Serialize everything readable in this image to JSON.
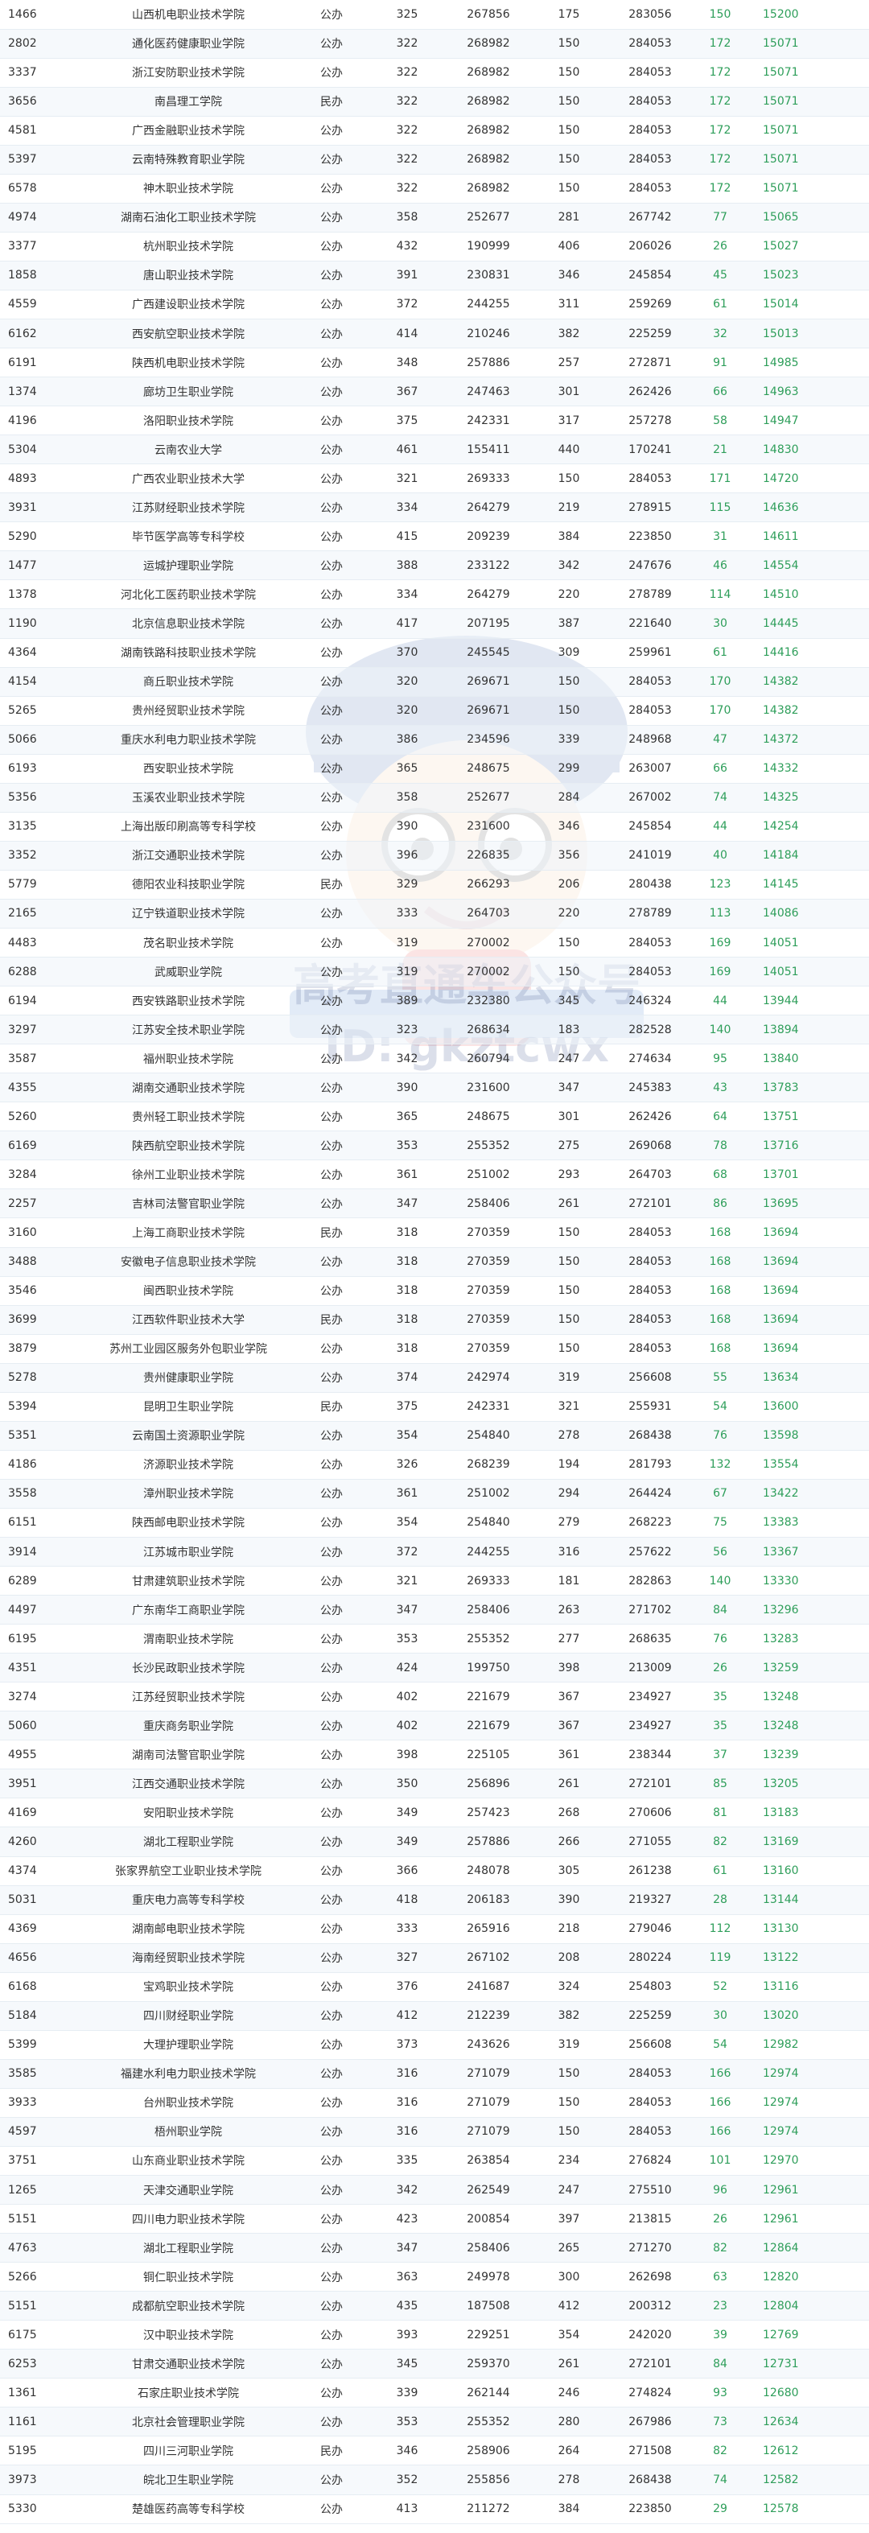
{
  "watermark": {
    "line1": "高考直通车公众号",
    "line2": "ID: gkztcwx"
  },
  "rows": [
    [
      "1466",
      "山西机电职业技术学院",
      "公办",
      "325",
      "267856",
      "175",
      "283056",
      "150",
      "15200"
    ],
    [
      "2802",
      "通化医药健康职业学院",
      "公办",
      "322",
      "268982",
      "150",
      "284053",
      "172",
      "15071"
    ],
    [
      "3337",
      "浙江安防职业技术学院",
      "公办",
      "322",
      "268982",
      "150",
      "284053",
      "172",
      "15071"
    ],
    [
      "3656",
      "南昌理工学院",
      "民办",
      "322",
      "268982",
      "150",
      "284053",
      "172",
      "15071"
    ],
    [
      "4581",
      "广西金融职业技术学院",
      "公办",
      "322",
      "268982",
      "150",
      "284053",
      "172",
      "15071"
    ],
    [
      "5397",
      "云南特殊教育职业学院",
      "公办",
      "322",
      "268982",
      "150",
      "284053",
      "172",
      "15071"
    ],
    [
      "6578",
      "神木职业技术学院",
      "公办",
      "322",
      "268982",
      "150",
      "284053",
      "172",
      "15071"
    ],
    [
      "4974",
      "湖南石油化工职业技术学院",
      "公办",
      "358",
      "252677",
      "281",
      "267742",
      "77",
      "15065"
    ],
    [
      "3377",
      "杭州职业技术学院",
      "公办",
      "432",
      "190999",
      "406",
      "206026",
      "26",
      "15027"
    ],
    [
      "1858",
      "唐山职业技术学院",
      "公办",
      "391",
      "230831",
      "346",
      "245854",
      "45",
      "15023"
    ],
    [
      "4559",
      "广西建设职业技术学院",
      "公办",
      "372",
      "244255",
      "311",
      "259269",
      "61",
      "15014"
    ],
    [
      "6162",
      "西安航空职业技术学院",
      "公办",
      "414",
      "210246",
      "382",
      "225259",
      "32",
      "15013"
    ],
    [
      "6191",
      "陕西机电职业技术学院",
      "公办",
      "348",
      "257886",
      "257",
      "272871",
      "91",
      "14985"
    ],
    [
      "1374",
      "廊坊卫生职业学院",
      "公办",
      "367",
      "247463",
      "301",
      "262426",
      "66",
      "14963"
    ],
    [
      "4196",
      "洛阳职业技术学院",
      "公办",
      "375",
      "242331",
      "317",
      "257278",
      "58",
      "14947"
    ],
    [
      "5304",
      "云南农业大学",
      "公办",
      "461",
      "155411",
      "440",
      "170241",
      "21",
      "14830"
    ],
    [
      "4893",
      "广西农业职业技术大学",
      "公办",
      "321",
      "269333",
      "150",
      "284053",
      "171",
      "14720"
    ],
    [
      "3931",
      "江苏财经职业技术学院",
      "公办",
      "334",
      "264279",
      "219",
      "278915",
      "115",
      "14636"
    ],
    [
      "5290",
      "毕节医学高等专科学校",
      "公办",
      "415",
      "209239",
      "384",
      "223850",
      "31",
      "14611"
    ],
    [
      "1477",
      "运城护理职业学院",
      "公办",
      "388",
      "233122",
      "342",
      "247676",
      "46",
      "14554"
    ],
    [
      "1378",
      "河北化工医药职业技术学院",
      "公办",
      "334",
      "264279",
      "220",
      "278789",
      "114",
      "14510"
    ],
    [
      "1190",
      "北京信息职业技术学院",
      "公办",
      "417",
      "207195",
      "387",
      "221640",
      "30",
      "14445"
    ],
    [
      "4364",
      "湖南铁路科技职业技术学院",
      "公办",
      "370",
      "245545",
      "309",
      "259961",
      "61",
      "14416"
    ],
    [
      "4154",
      "商丘职业技术学院",
      "公办",
      "320",
      "269671",
      "150",
      "284053",
      "170",
      "14382"
    ],
    [
      "5265",
      "贵州经贸职业技术学院",
      "公办",
      "320",
      "269671",
      "150",
      "284053",
      "170",
      "14382"
    ],
    [
      "5066",
      "重庆水利电力职业技术学院",
      "公办",
      "386",
      "234596",
      "339",
      "248968",
      "47",
      "14372"
    ],
    [
      "6193",
      "西安职业技术学院",
      "公办",
      "365",
      "248675",
      "299",
      "263007",
      "66",
      "14332"
    ],
    [
      "5356",
      "玉溪农业职业技术学院",
      "公办",
      "358",
      "252677",
      "284",
      "267002",
      "74",
      "14325"
    ],
    [
      "3135",
      "上海出版印刷高等专科学校",
      "公办",
      "390",
      "231600",
      "346",
      "245854",
      "44",
      "14254"
    ],
    [
      "3352",
      "浙江交通职业技术学院",
      "公办",
      "396",
      "226835",
      "356",
      "241019",
      "40",
      "14184"
    ],
    [
      "5779",
      "德阳农业科技职业学院",
      "民办",
      "329",
      "266293",
      "206",
      "280438",
      "123",
      "14145"
    ],
    [
      "2165",
      "辽宁铁道职业技术学院",
      "公办",
      "333",
      "264703",
      "220",
      "278789",
      "113",
      "14086"
    ],
    [
      "4483",
      "茂名职业技术学院",
      "公办",
      "319",
      "270002",
      "150",
      "284053",
      "169",
      "14051"
    ],
    [
      "6288",
      "武威职业学院",
      "公办",
      "319",
      "270002",
      "150",
      "284053",
      "169",
      "14051"
    ],
    [
      "6194",
      "西安铁路职业技术学院",
      "公办",
      "389",
      "232380",
      "345",
      "246324",
      "44",
      "13944"
    ],
    [
      "3297",
      "江苏安全技术职业学院",
      "公办",
      "323",
      "268634",
      "183",
      "282528",
      "140",
      "13894"
    ],
    [
      "3587",
      "福州职业技术学院",
      "公办",
      "342",
      "260794",
      "247",
      "274634",
      "95",
      "13840"
    ],
    [
      "4355",
      "湖南交通职业技术学院",
      "公办",
      "390",
      "231600",
      "347",
      "245383",
      "43",
      "13783"
    ],
    [
      "5260",
      "贵州轻工职业技术学院",
      "公办",
      "365",
      "248675",
      "301",
      "262426",
      "64",
      "13751"
    ],
    [
      "6169",
      "陕西航空职业技术学院",
      "公办",
      "353",
      "255352",
      "275",
      "269068",
      "78",
      "13716"
    ],
    [
      "3284",
      "徐州工业职业技术学院",
      "公办",
      "361",
      "251002",
      "293",
      "264703",
      "68",
      "13701"
    ],
    [
      "2257",
      "吉林司法警官职业学院",
      "公办",
      "347",
      "258406",
      "261",
      "272101",
      "86",
      "13695"
    ],
    [
      "3160",
      "上海工商职业技术学院",
      "民办",
      "318",
      "270359",
      "150",
      "284053",
      "168",
      "13694"
    ],
    [
      "3488",
      "安徽电子信息职业技术学院",
      "公办",
      "318",
      "270359",
      "150",
      "284053",
      "168",
      "13694"
    ],
    [
      "3546",
      "闽西职业技术学院",
      "公办",
      "318",
      "270359",
      "150",
      "284053",
      "168",
      "13694"
    ],
    [
      "3699",
      "江西软件职业技术大学",
      "民办",
      "318",
      "270359",
      "150",
      "284053",
      "168",
      "13694"
    ],
    [
      "3879",
      "苏州工业园区服务外包职业学院",
      "公办",
      "318",
      "270359",
      "150",
      "284053",
      "168",
      "13694"
    ],
    [
      "5278",
      "贵州健康职业学院",
      "公办",
      "374",
      "242974",
      "319",
      "256608",
      "55",
      "13634"
    ],
    [
      "5394",
      "昆明卫生职业学院",
      "民办",
      "375",
      "242331",
      "321",
      "255931",
      "54",
      "13600"
    ],
    [
      "5351",
      "云南国土资源职业学院",
      "公办",
      "354",
      "254840",
      "278",
      "268438",
      "76",
      "13598"
    ],
    [
      "4186",
      "济源职业技术学院",
      "公办",
      "326",
      "268239",
      "194",
      "281793",
      "132",
      "13554"
    ],
    [
      "3558",
      "漳州职业技术学院",
      "公办",
      "361",
      "251002",
      "294",
      "264424",
      "67",
      "13422"
    ],
    [
      "6151",
      "陕西邮电职业技术学院",
      "公办",
      "354",
      "254840",
      "279",
      "268223",
      "75",
      "13383"
    ],
    [
      "3914",
      "江苏城市职业学院",
      "公办",
      "372",
      "244255",
      "316",
      "257622",
      "56",
      "13367"
    ],
    [
      "6289",
      "甘肃建筑职业技术学院",
      "公办",
      "321",
      "269333",
      "181",
      "282863",
      "140",
      "13330"
    ],
    [
      "4497",
      "广东南华工商职业学院",
      "公办",
      "347",
      "258406",
      "263",
      "271702",
      "84",
      "13296"
    ],
    [
      "6195",
      "渭南职业技术学院",
      "公办",
      "353",
      "255352",
      "277",
      "268635",
      "76",
      "13283"
    ],
    [
      "4351",
      "长沙民政职业技术学院",
      "公办",
      "424",
      "199750",
      "398",
      "213009",
      "26",
      "13259"
    ],
    [
      "3274",
      "江苏经贸职业技术学院",
      "公办",
      "402",
      "221679",
      "367",
      "234927",
      "35",
      "13248"
    ],
    [
      "5060",
      "重庆商务职业学院",
      "公办",
      "402",
      "221679",
      "367",
      "234927",
      "35",
      "13248"
    ],
    [
      "4955",
      "湖南司法警官职业学院",
      "公办",
      "398",
      "225105",
      "361",
      "238344",
      "37",
      "13239"
    ],
    [
      "3951",
      "江西交通职业技术学院",
      "公办",
      "350",
      "256896",
      "261",
      "272101",
      "85",
      "13205"
    ],
    [
      "4169",
      "安阳职业技术学院",
      "公办",
      "349",
      "257423",
      "268",
      "270606",
      "81",
      "13183"
    ],
    [
      "4260",
      "湖北工程职业学院",
      "公办",
      "349",
      "257886",
      "266",
      "271055",
      "82",
      "13169"
    ],
    [
      "4374",
      "张家界航空工业职业技术学院",
      "公办",
      "366",
      "248078",
      "305",
      "261238",
      "61",
      "13160"
    ],
    [
      "5031",
      "重庆电力高等专科学校",
      "公办",
      "418",
      "206183",
      "390",
      "219327",
      "28",
      "13144"
    ],
    [
      "4369",
      "湖南邮电职业技术学院",
      "公办",
      "333",
      "265916",
      "218",
      "279046",
      "112",
      "13130"
    ],
    [
      "4656",
      "海南经贸职业技术学院",
      "公办",
      "327",
      "267102",
      "208",
      "280224",
      "119",
      "13122"
    ],
    [
      "6168",
      "宝鸡职业技术学院",
      "公办",
      "376",
      "241687",
      "324",
      "254803",
      "52",
      "13116"
    ],
    [
      "5184",
      "四川财经职业学院",
      "公办",
      "412",
      "212239",
      "382",
      "225259",
      "30",
      "13020"
    ],
    [
      "5399",
      "大理护理职业学院",
      "公办",
      "373",
      "243626",
      "319",
      "256608",
      "54",
      "12982"
    ],
    [
      "3585",
      "福建水利电力职业技术学院",
      "公办",
      "316",
      "271079",
      "150",
      "284053",
      "166",
      "12974"
    ],
    [
      "3933",
      "台州职业技术学院",
      "公办",
      "316",
      "271079",
      "150",
      "284053",
      "166",
      "12974"
    ],
    [
      "4597",
      "梧州职业学院",
      "公办",
      "316",
      "271079",
      "150",
      "284053",
      "166",
      "12974"
    ],
    [
      "3751",
      "山东商业职业技术学院",
      "公办",
      "335",
      "263854",
      "234",
      "276824",
      "101",
      "12970"
    ],
    [
      "1265",
      "天津交通职业学院",
      "公办",
      "342",
      "262549",
      "247",
      "275510",
      "96",
      "12961"
    ],
    [
      "5151",
      "四川电力职业技术学院",
      "公办",
      "423",
      "200854",
      "397",
      "213815",
      "26",
      "12961"
    ],
    [
      "4763",
      "湖北工程职业学院",
      "公办",
      "347",
      "258406",
      "265",
      "271270",
      "82",
      "12864"
    ],
    [
      "5266",
      "铜仁职业技术学院",
      "公办",
      "363",
      "249978",
      "300",
      "262698",
      "63",
      "12820"
    ],
    [
      "5151",
      "成都航空职业技术学院",
      "公办",
      "435",
      "187508",
      "412",
      "200312",
      "23",
      "12804"
    ],
    [
      "6175",
      "汉中职业技术学院",
      "公办",
      "393",
      "229251",
      "354",
      "242020",
      "39",
      "12769"
    ],
    [
      "6253",
      "甘肃交通职业技术学院",
      "公办",
      "345",
      "259370",
      "261",
      "272101",
      "84",
      "12731"
    ],
    [
      "1361",
      "石家庄职业技术学院",
      "公办",
      "339",
      "262144",
      "246",
      "274824",
      "93",
      "12680"
    ],
    [
      "1161",
      "北京社会管理职业学院",
      "公办",
      "353",
      "255352",
      "280",
      "267986",
      "73",
      "12634"
    ],
    [
      "5195",
      "四川三河职业学院",
      "民办",
      "346",
      "258906",
      "264",
      "271508",
      "82",
      "12612"
    ],
    [
      "3973",
      "皖北卫生职业学院",
      "公办",
      "352",
      "255856",
      "278",
      "268438",
      "74",
      "12582"
    ],
    [
      "5330",
      "楚雄医药高等专科学校",
      "公办",
      "413",
      "211272",
      "384",
      "223850",
      "29",
      "12578"
    ]
  ]
}
